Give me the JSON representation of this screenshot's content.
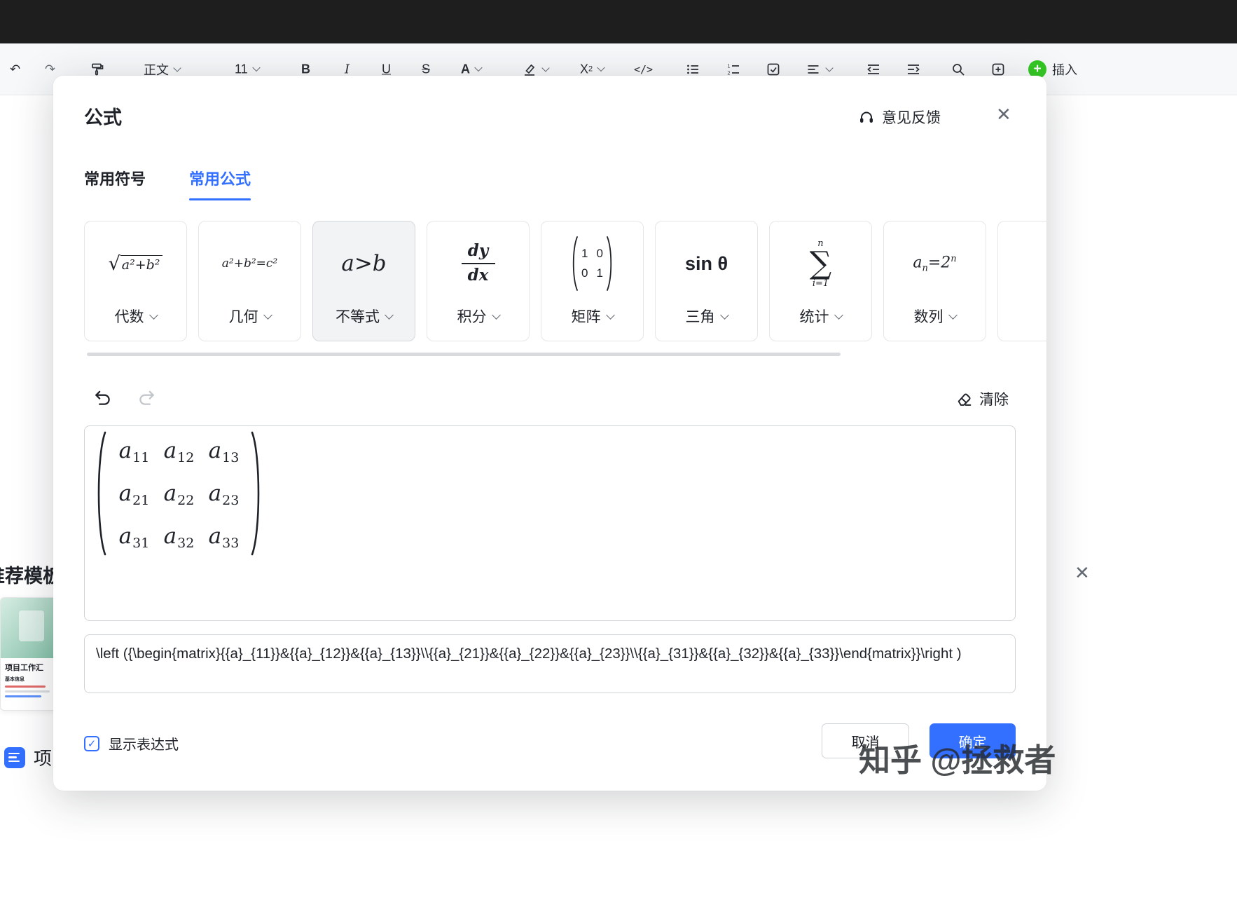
{
  "icons": {
    "close": "✕",
    "undo_arrow": "↶",
    "redo_arrow": "↷",
    "check": "✓",
    "plus": "+"
  },
  "toolbar": {
    "style": "正文",
    "size": "11",
    "bold": "B",
    "italic": "I",
    "underline": "U",
    "strike": "S",
    "color": "A",
    "sup_base": "X",
    "sup_exp": "2",
    "code": "</>",
    "insert": "插入"
  },
  "sidebar": {
    "templates_heading": "推荐模板",
    "template_title": "项目工作汇",
    "template_section": "基本信息",
    "doc_label": "项目"
  },
  "dialog": {
    "title": "公式",
    "feedback": "意见反馈",
    "tabs": [
      {
        "label": "常用符号"
      },
      {
        "label": "常用公式"
      }
    ],
    "cards": [
      {
        "label": "代数",
        "radical": "√",
        "body": "a²+b²"
      },
      {
        "label": "几何",
        "body": "a²+b²=c²"
      },
      {
        "label": "不等式",
        "body": "a>b",
        "selected": true
      },
      {
        "label": "积分",
        "numerator": "dy",
        "denominator": "dx"
      },
      {
        "label": "矩阵",
        "cells": [
          "1",
          "0",
          "0",
          "1"
        ]
      },
      {
        "label": "三角",
        "body": "sin θ"
      },
      {
        "label": "统计",
        "sigma": "∑",
        "upper": "n",
        "lower": "i=1"
      },
      {
        "label": "数列",
        "base": "a",
        "sub": "n",
        "rhs": "=2",
        "sup": "n"
      }
    ],
    "clear": "清除",
    "matrix": {
      "cells": [
        {
          "sym": "a",
          "sub": "11"
        },
        {
          "sym": "a",
          "sub": "12"
        },
        {
          "sym": "a",
          "sub": "13"
        },
        {
          "sym": "a",
          "sub": "21"
        },
        {
          "sym": "a",
          "sub": "22"
        },
        {
          "sym": "a",
          "sub": "23"
        },
        {
          "sym": "a",
          "sub": "31"
        },
        {
          "sym": "a",
          "sub": "32"
        },
        {
          "sym": "a",
          "sub": "33"
        }
      ]
    },
    "latex": "\\left ({\\begin{matrix}{{a}_{11}}&{{a}_{12}}&{{a}_{13}}\\\\{{a}_{21}}&{{a}_{22}}&{{a}_{23}}\\\\{{a}_{31}}&{{a}_{32}}&{{a}_{33}}\\end{matrix}}\\right )",
    "show_expression": "显示表达式",
    "cancel": "取消",
    "confirm": "确定"
  },
  "watermark": "知乎 @拯救者",
  "colors": {
    "accent": "#3370ff",
    "insert_green": "#34c724",
    "selected_card_bg": "#f2f3f5"
  }
}
